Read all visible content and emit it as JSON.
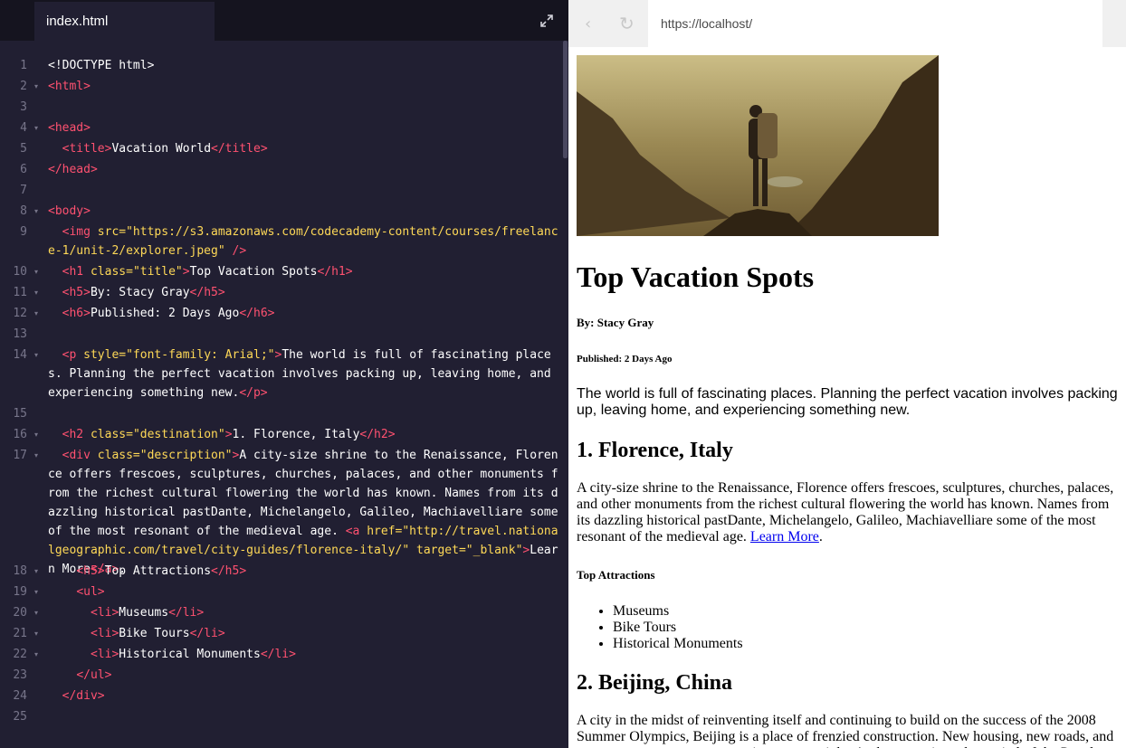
{
  "editor": {
    "tab_label": "index.html",
    "lines": [
      {
        "n": "1",
        "fold": false,
        "html": "&lt;!DOCTYPE html&gt;"
      },
      {
        "n": "2",
        "fold": true,
        "html": "<span class=\"tg\">&lt;html&gt;</span>"
      },
      {
        "n": "3",
        "fold": false,
        "html": ""
      },
      {
        "n": "4",
        "fold": true,
        "html": "<span class=\"tg\">&lt;head&gt;</span>"
      },
      {
        "n": "5",
        "fold": false,
        "html": "  <span class=\"tg\">&lt;title&gt;</span>Vacation World<span class=\"tg\">&lt;/title&gt;</span>"
      },
      {
        "n": "6",
        "fold": false,
        "html": "<span class=\"tg\">&lt;/head&gt;</span>"
      },
      {
        "n": "7",
        "fold": false,
        "html": ""
      },
      {
        "n": "8",
        "fold": true,
        "html": "<span class=\"tg\">&lt;body&gt;</span>"
      },
      {
        "n": "9",
        "fold": false,
        "wrap": "wrap2",
        "html": "  <span class=\"tg\">&lt;img</span> <span class=\"at\">src=</span><span class=\"st\">\"https://s3.amazonaws.com/codecademy-content/courses/freelance-1/unit-2/explorer.jpeg\"</span> <span class=\"tg\">/&gt;</span>"
      },
      {
        "n": "10",
        "fold": true,
        "html": "  <span class=\"tg\">&lt;h1</span> <span class=\"at\">class=</span><span class=\"st\">\"title\"</span><span class=\"tg\">&gt;</span>Top Vacation Spots<span class=\"tg\">&lt;/h1&gt;</span>"
      },
      {
        "n": "11",
        "fold": true,
        "html": "  <span class=\"tg\">&lt;h5&gt;</span>By: Stacy Gray<span class=\"tg\">&lt;/h5&gt;</span>"
      },
      {
        "n": "12",
        "fold": true,
        "html": "  <span class=\"tg\">&lt;h6&gt;</span>Published: 2 Days Ago<span class=\"tg\">&lt;/h6&gt;</span>"
      },
      {
        "n": "13",
        "fold": false,
        "html": ""
      },
      {
        "n": "14",
        "fold": true,
        "wrap": "wrap3",
        "html": "  <span class=\"tg\">&lt;p</span> <span class=\"at\">style=</span><span class=\"st\">\"font-family: Arial;\"</span><span class=\"tg\">&gt;</span>The world is full of fascinating places. Planning the perfect vacation involves packing up, leaving home, and experiencing something new.<span class=\"tg\">&lt;/p&gt;</span>"
      },
      {
        "n": "15",
        "fold": false,
        "html": ""
      },
      {
        "n": "16",
        "fold": true,
        "html": "  <span class=\"tg\">&lt;h2</span> <span class=\"at\">class=</span><span class=\"st\">\"destination\"</span><span class=\"tg\">&gt;</span>1. Florence, Italy<span class=\"tg\">&lt;/h2&gt;</span>"
      },
      {
        "n": "17",
        "fold": true,
        "wrap": "wrap6",
        "html": "  <span class=\"tg\">&lt;div</span> <span class=\"at\">class=</span><span class=\"st\">\"description\"</span><span class=\"tg\">&gt;</span>A city-size shrine to the Renaissance, Florence offers frescoes, sculptures, churches, palaces, and other monuments from the richest cultural flowering the world has known. Names from its dazzling historical pastDante, Michelangelo, Galileo, Machiavelliare some of the most resonant of the medieval age. <span class=\"tg\">&lt;a</span> <span class=\"at\">href=</span><span class=\"st\">\"http://travel.nationalgeographic.com/travel/city-guides/florence-italy/\"</span> <span class=\"at\">target=</span><span class=\"st\">\"_blank\"</span><span class=\"tg\">&gt;</span>Learn More<span class=\"tg\">&lt;/a&gt;</span>."
      },
      {
        "n": "18",
        "fold": true,
        "html": "    <span class=\"tg\">&lt;h5&gt;</span>Top Attractions<span class=\"tg\">&lt;/h5&gt;</span>"
      },
      {
        "n": "19",
        "fold": true,
        "html": "    <span class=\"tg\">&lt;ul&gt;</span>"
      },
      {
        "n": "20",
        "fold": true,
        "html": "      <span class=\"tg\">&lt;li&gt;</span>Museums<span class=\"tg\">&lt;/li&gt;</span>"
      },
      {
        "n": "21",
        "fold": true,
        "html": "      <span class=\"tg\">&lt;li&gt;</span>Bike Tours<span class=\"tg\">&lt;/li&gt;</span>"
      },
      {
        "n": "22",
        "fold": true,
        "html": "      <span class=\"tg\">&lt;li&gt;</span>Historical Monuments<span class=\"tg\">&lt;/li&gt;</span>"
      },
      {
        "n": "23",
        "fold": false,
        "html": "    <span class=\"tg\">&lt;/ul&gt;</span>"
      },
      {
        "n": "24",
        "fold": false,
        "html": "  <span class=\"tg\">&lt;/div&gt;</span>"
      },
      {
        "n": "25",
        "fold": false,
        "html": ""
      }
    ]
  },
  "browser": {
    "url": "https://localhost/",
    "page": {
      "h1": "Top Vacation Spots",
      "author": "By: Stacy Gray",
      "published": "Published: 2 Days Ago",
      "intro": "The world is full of fascinating places. Planning the perfect vacation involves packing up, leaving home, and experiencing something new.",
      "dest1_title": "1. Florence, Italy",
      "dest1_desc": "A city-size shrine to the Renaissance, Florence offers frescoes, sculptures, churches, palaces, and other monuments from the richest cultural flowering the world has known. Names from its dazzling historical pastDante, Michelangelo, Galileo, Machiavelliare some of the most resonant of the medieval age.",
      "dest1_link": "Learn More",
      "dest1_link_suffix": ".",
      "attractions_title": "Top Attractions",
      "attractions": [
        "Museums",
        "Bike Tours",
        "Historical Monuments"
      ],
      "dest2_title": "2. Beijing, China",
      "dest2_desc": "A city in the midst of reinventing itself and continuing to build on the success of the 2008 Summer Olympics, Beijing is a place of frenzied construction. New housing, new roads, and new sports venues seem to spring up overnight. At the same time, the capital of the Peoples"
    }
  }
}
